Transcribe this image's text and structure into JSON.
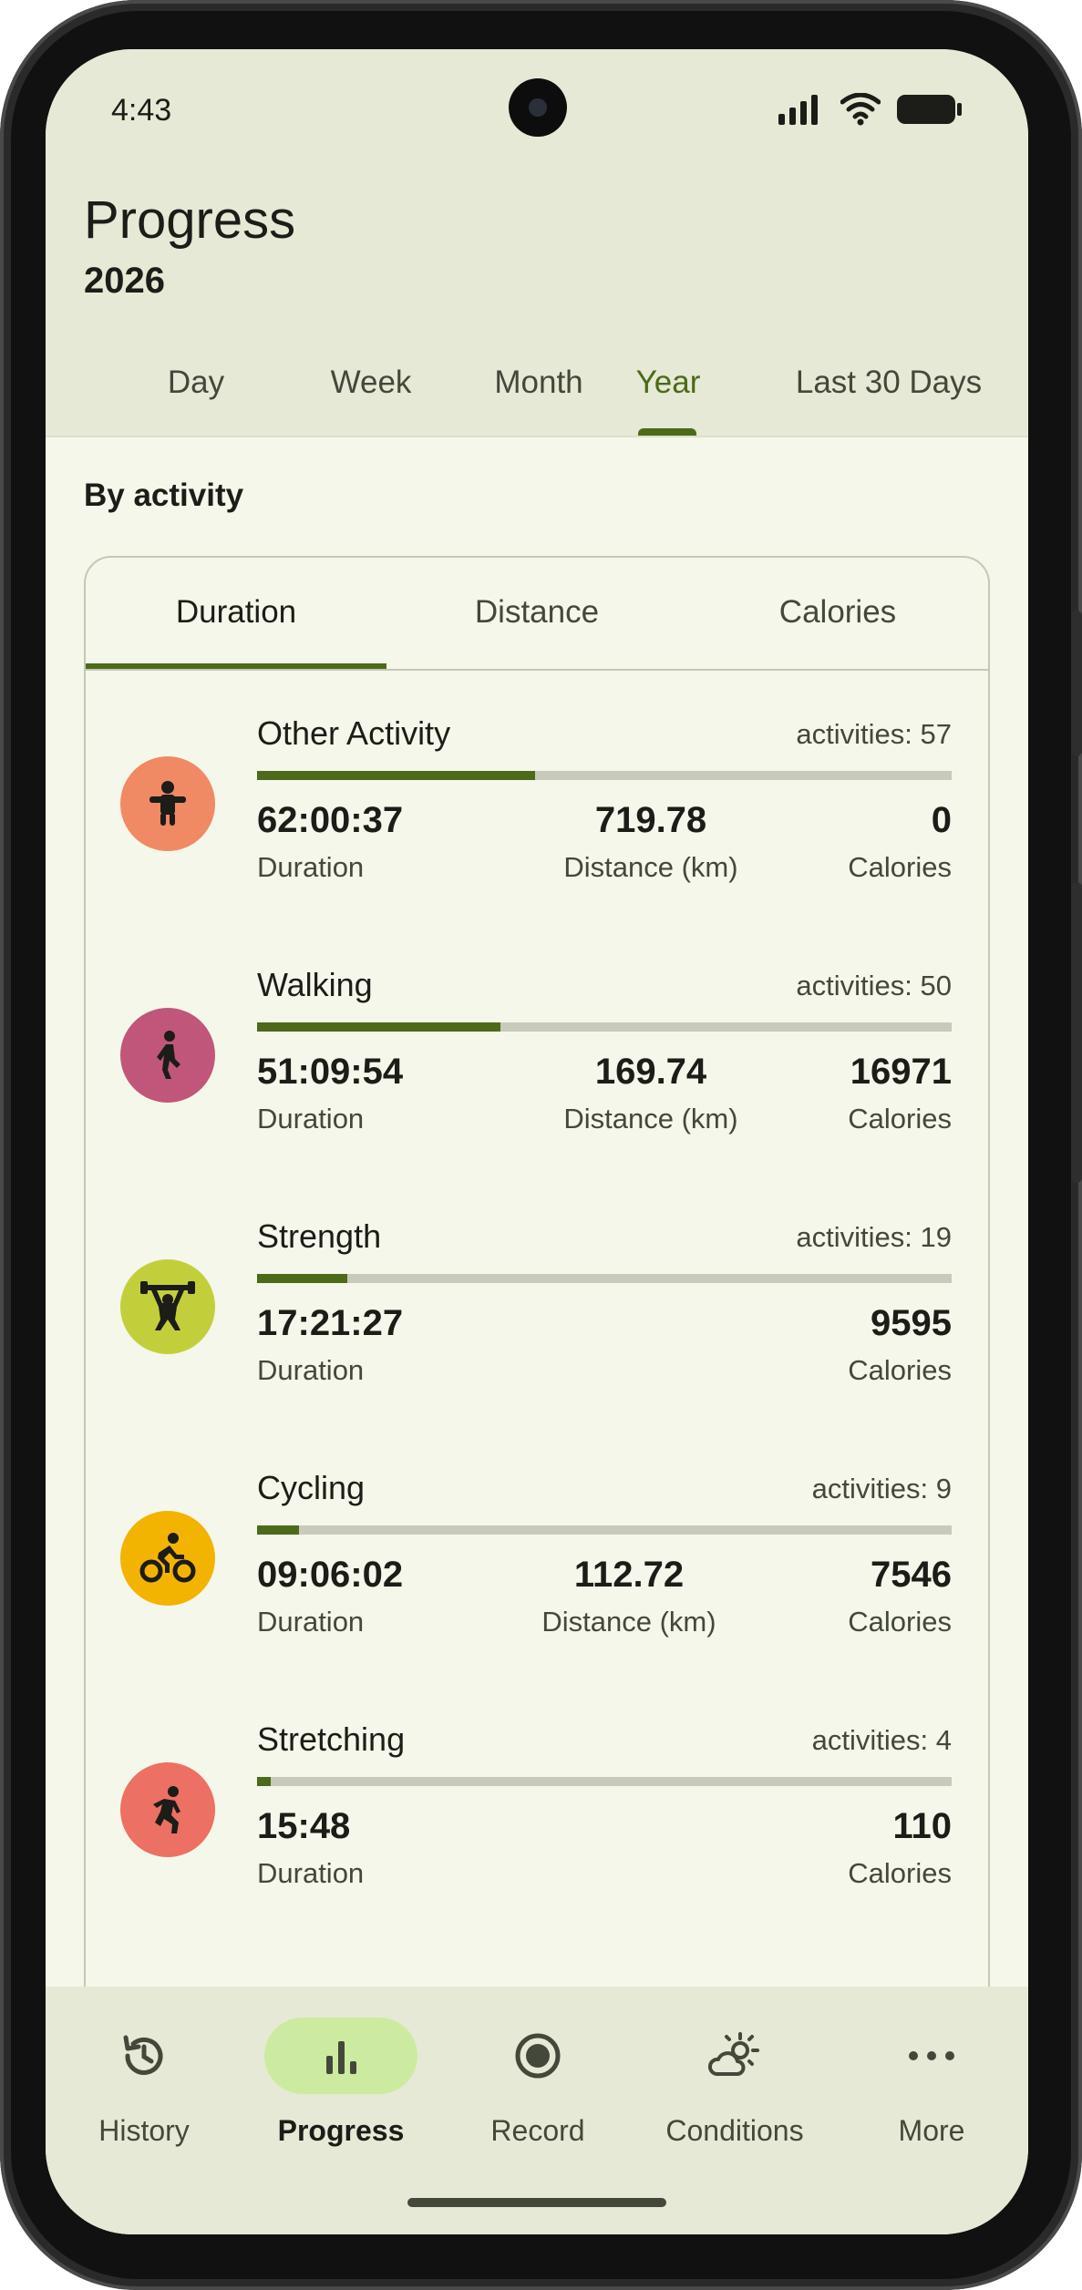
{
  "status_bar": {
    "time": "4:43"
  },
  "header": {
    "title": "Progress",
    "year": "2026"
  },
  "period_tabs": [
    {
      "label": "Day"
    },
    {
      "label": "Week"
    },
    {
      "label": "Month"
    },
    {
      "label": "Year"
    },
    {
      "label": "Last 30 Days"
    }
  ],
  "period_selected": "Year",
  "section": {
    "title": "By activity"
  },
  "metric_tabs": [
    {
      "label": "Duration"
    },
    {
      "label": "Distance"
    },
    {
      "label": "Calories"
    }
  ],
  "metric_selected": "Duration",
  "activities": [
    {
      "name": "Other Activity",
      "count": "activities: 57",
      "icon": "other-activity-icon",
      "color": "#f08a64",
      "progress": 0.4,
      "duration": "62:00:37",
      "duration_label": "Duration",
      "distance": "719.78",
      "distance_label": "Distance (km)",
      "calories": "0",
      "calories_label": "Calories"
    },
    {
      "name": "Walking",
      "count": "activities: 50",
      "icon": "walking-icon",
      "color": "#c0577a",
      "progress": 0.35,
      "duration": "51:09:54",
      "duration_label": "Duration",
      "distance": "169.74",
      "distance_label": "Distance (km)",
      "calories": "16971",
      "calories_label": "Calories"
    },
    {
      "name": "Strength",
      "count": "activities: 19",
      "icon": "strength-icon",
      "color": "#c3cf3a",
      "progress": 0.13,
      "duration": "17:21:27",
      "duration_label": "Duration",
      "calories": "9595",
      "calories_label": "Calories"
    },
    {
      "name": "Cycling",
      "count": "activities: 9",
      "icon": "cycling-icon",
      "color": "#f3b301",
      "progress": 0.06,
      "duration": "09:06:02",
      "duration_label": "Duration",
      "distance": "112.72",
      "distance_label": "Distance (km)",
      "calories": "7546",
      "calories_label": "Calories"
    },
    {
      "name": "Stretching",
      "count": "activities: 4",
      "icon": "stretching-icon",
      "color": "#ec7063",
      "progress": 0.02,
      "duration": "15:48",
      "duration_label": "Duration",
      "calories": "110",
      "calories_label": "Calories"
    }
  ],
  "bottom_nav": [
    {
      "label": "History",
      "icon": "history-icon"
    },
    {
      "label": "Progress",
      "icon": "bar-chart-icon"
    },
    {
      "label": "Record",
      "icon": "record-icon"
    },
    {
      "label": "Conditions",
      "icon": "weather-icon"
    },
    {
      "label": "More",
      "icon": "more-icon"
    }
  ],
  "bottom_nav_selected": "Progress",
  "colors": {
    "accent": "#4c6a1a",
    "nav_active_pill": "#cdeba0",
    "background": "#f4f7e9",
    "header_bg": "#e6e9d5"
  }
}
